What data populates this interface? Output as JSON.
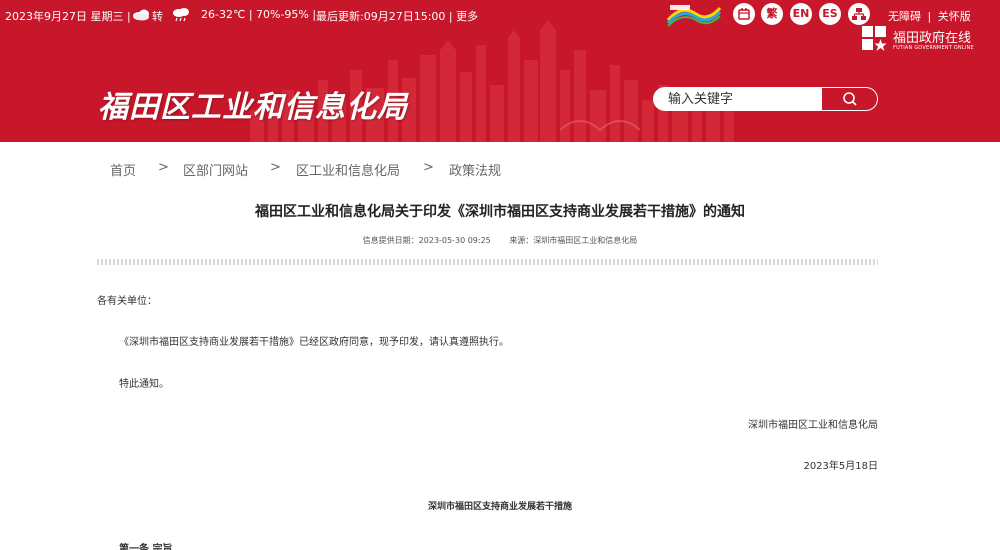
{
  "topbar": {
    "date": "2023年9月27日 星期三 |",
    "weather_desc": "转",
    "temperature": "26-32℃ | 70%-95% |",
    "update_time": "最后更新:09月27日15:00 | 更多",
    "weather_icon_1": "cloud-icon",
    "weather_icon_2": "rain-cloud-icon"
  },
  "tools": {
    "calendar_icon": "calendar-icon",
    "traditional_label": "繁",
    "english_label": "EN",
    "spanish_label": "ES",
    "sitemap_icon": "sitemap-icon",
    "accessibility_label": "无障碍",
    "separator": "|",
    "elderly_label": "关怀版"
  },
  "gov_logo": {
    "title": "福田政府在线",
    "subtitle": "FUTIAN GOVERNMENT ONLINE"
  },
  "site": {
    "title": "福田区工业和信息化局"
  },
  "search": {
    "placeholder": "输入关键字"
  },
  "breadcrumb": {
    "items": [
      "首页",
      "区部门网站",
      "区工业和信息化局",
      "政策法规"
    ],
    "separator": ">"
  },
  "article": {
    "title": "福田区工业和信息化局关于印发《深圳市福田区支持商业发展若干措施》的通知",
    "meta_date": "信息提供日期：2023-05-30 09:25",
    "meta_source": "来源：深圳市福田区工业和信息化局",
    "salutation": "各有关单位：",
    "paragraph_1": "《深圳市福田区支持商业发展若干措施》已经区政府同意，现予印发，请认真遵照执行。",
    "paragraph_2": "特此通知。",
    "signature": "深圳市福田区工业和信息化局",
    "date": "2023年5月18日",
    "subheading": "深圳市福田区支持商业发展若干措施",
    "section_1": "第一条 宗旨"
  },
  "colors": {
    "brand_red": "#c8162a"
  }
}
